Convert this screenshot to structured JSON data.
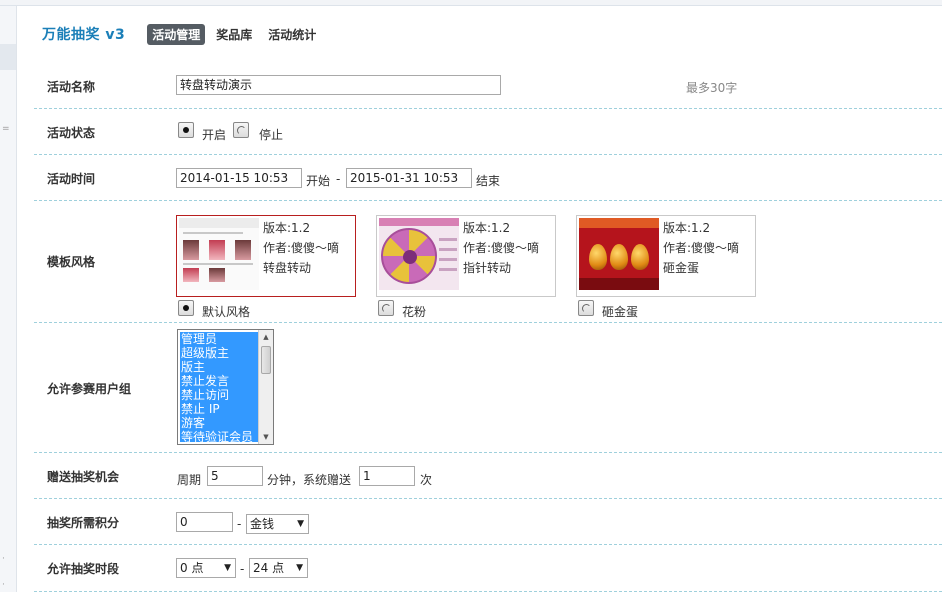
{
  "header": {
    "app_title": "万能抽奖 v3",
    "tabs": [
      {
        "label": "活动管理",
        "active": true
      },
      {
        "label": "奖品库",
        "active": false
      },
      {
        "label": "活动统计",
        "active": false
      }
    ]
  },
  "form": {
    "name": {
      "label": "活动名称",
      "value": "转盘转动演示",
      "hint": "最多30字"
    },
    "status": {
      "label": "活动状态",
      "options": [
        {
          "label": "开启",
          "checked": true
        },
        {
          "label": "停止",
          "checked": false
        }
      ]
    },
    "time": {
      "label": "活动时间",
      "start_value": "2014-01-15 10:53",
      "start_suffix": "开始",
      "separator": "-",
      "end_value": "2015-01-31 10:53",
      "end_suffix": "结束"
    },
    "template": {
      "label": "模板风格",
      "items": [
        {
          "version": "版本:1.2",
          "author": "作者:傻傻～嘀",
          "kind": "转盘转动",
          "option_label": "默认风格",
          "checked": true
        },
        {
          "version": "版本:1.2",
          "author": "作者:傻傻～嘀",
          "kind": "指针转动",
          "option_label": "花粉",
          "checked": false
        },
        {
          "version": "版本:1.2",
          "author": "作者:傻傻～嘀",
          "kind": "砸金蛋",
          "option_label": "砸金蛋",
          "checked": false
        }
      ]
    },
    "user_groups": {
      "label": "允许参赛用户组",
      "options": [
        "管理员",
        "超级版主",
        "版主",
        "禁止发言",
        "禁止访问",
        "禁止 IP",
        "游客",
        "等待验证会员"
      ]
    },
    "bonus": {
      "label": "赠送抽奖机会",
      "prefix": "周期",
      "period_value": "5",
      "middle": "分钟，系统赠送",
      "count_value": "1",
      "suffix": "次"
    },
    "points": {
      "label": "抽奖所需积分",
      "value": "0",
      "separator": "-",
      "currency_selected": "金钱"
    },
    "hours": {
      "label": "允许抽奖时段",
      "start_selected": "0 点",
      "separator": "-",
      "end_selected": "24 点"
    }
  },
  "colors": {
    "accent": "#1b7fb8",
    "active_tab": "#555c63",
    "selected_border": "#b81f1f",
    "listbox_selection": "#3399ff",
    "row_divider": "#9fd0dc"
  }
}
